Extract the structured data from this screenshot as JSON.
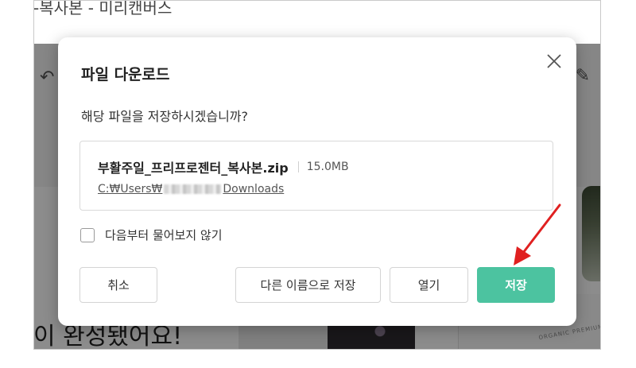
{
  "background": {
    "title": "-복사본 - 미리캔버스",
    "heading": "이 완성됐어요!",
    "organic_text": "ORGANIC PREMIUM"
  },
  "dialog": {
    "title": "파일 다운로드",
    "question": "해당 파일을 저장하시겠습니까?",
    "file": {
      "name": "부활주일_프리프로젠터_복사본.zip",
      "size": "15.0MB",
      "path_prefix": "C:₩Users₩",
      "path_suffix": "Downloads"
    },
    "checkbox_label": "다음부터 물어보지 않기",
    "buttons": {
      "cancel": "취소",
      "save_as": "다른 이름으로 저장",
      "open": "열기",
      "save": "저장"
    }
  },
  "colors": {
    "accent": "#4cc3a0",
    "annotation_arrow": "#e02020"
  },
  "icons": [
    "close-icon",
    "undo-icon",
    "edit-icon",
    "red-arrow-annotation"
  ]
}
